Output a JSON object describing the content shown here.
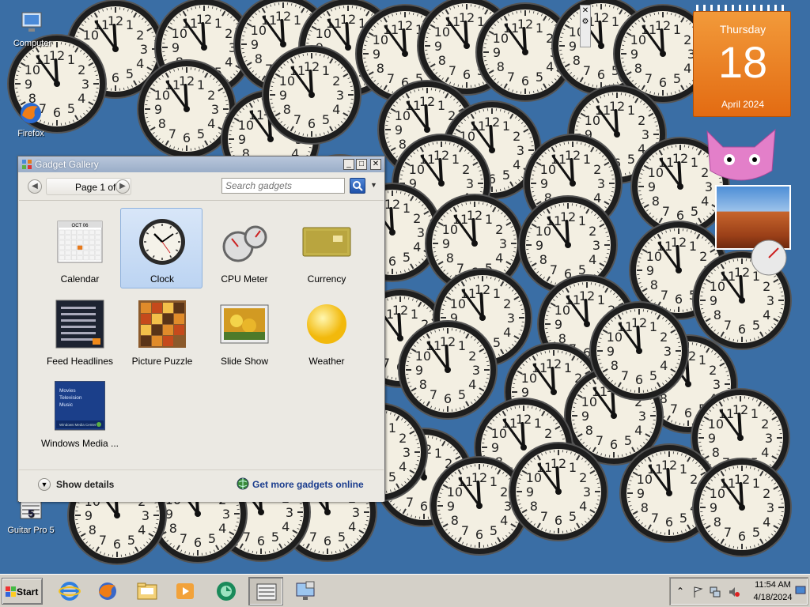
{
  "desktop": {
    "icons": [
      {
        "name": "desktop-icon-computer",
        "label": "Computer"
      },
      {
        "name": "desktop-icon-firefox",
        "label": "Firefox"
      },
      {
        "name": "desktop-icon-guitar-pro",
        "label": "Guitar Pro 5"
      }
    ],
    "accent": "#3a6ea5"
  },
  "calendar_gadget": {
    "day": "Thursday",
    "date": "18",
    "month_year": "April 2024",
    "color": "#e8781c"
  },
  "gallery": {
    "title": "Gadget Gallery",
    "page_label": "Page 1 of 1",
    "search_placeholder": "Search gadgets",
    "tiles": [
      {
        "name": "Calendar",
        "icon": "calendar-icon",
        "selected": false
      },
      {
        "name": "Clock",
        "icon": "clock-icon",
        "selected": true
      },
      {
        "name": "CPU Meter",
        "icon": "cpu-meter-icon",
        "selected": false
      },
      {
        "name": "Currency",
        "icon": "currency-icon",
        "selected": false
      },
      {
        "name": "Feed Headlines",
        "icon": "feed-headlines-icon",
        "selected": false
      },
      {
        "name": "Picture Puzzle",
        "icon": "picture-puzzle-icon",
        "selected": false
      },
      {
        "name": "Slide Show",
        "icon": "slide-show-icon",
        "selected": false
      },
      {
        "name": "Weather",
        "icon": "weather-icon",
        "selected": false
      },
      {
        "name": "Windows Media ...",
        "icon": "windows-media-center-icon",
        "selected": false
      }
    ],
    "show_details": "Show details",
    "more_gadgets": "Get more gadgets online",
    "thumb_calendar": {
      "month": "OCT 06"
    },
    "thumb_media": {
      "items": [
        "Movies",
        "Television",
        "Music"
      ],
      "caption": "Windows Media Center"
    }
  },
  "taskbar": {
    "start_label": "Start",
    "buttons": [
      {
        "name": "internet-explorer-icon"
      },
      {
        "name": "firefox-icon"
      },
      {
        "name": "file-explorer-icon"
      },
      {
        "name": "media-player-icon"
      },
      {
        "name": "chat-app-icon"
      },
      {
        "name": "guitar-pro-icon",
        "active": true
      },
      {
        "name": "remote-desktop-icon"
      }
    ],
    "tray": {
      "time": "11:54 AM",
      "date": "4/18/2024",
      "icons": [
        "chevron-up-icon",
        "flag-icon",
        "network-icon",
        "volume-muted-icon"
      ]
    }
  }
}
